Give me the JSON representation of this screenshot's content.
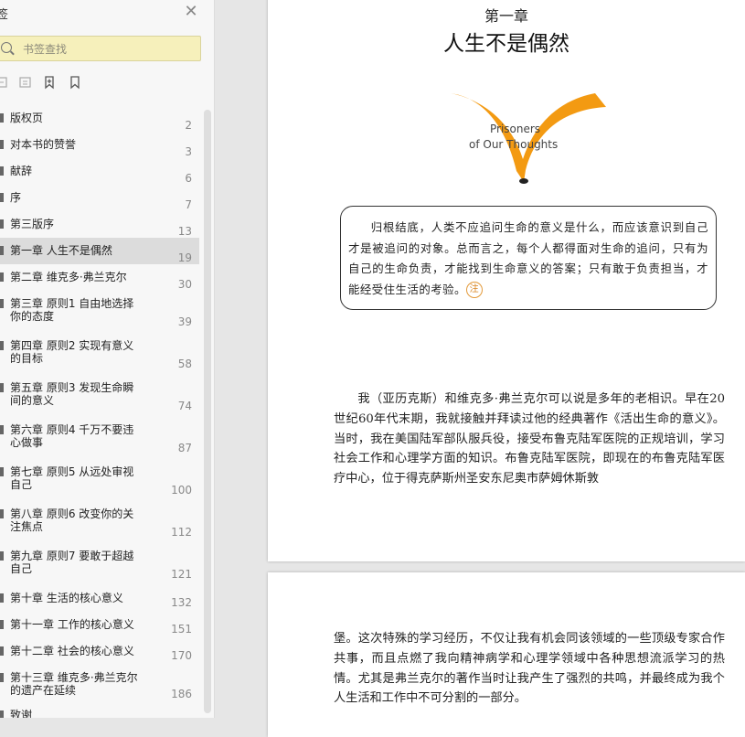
{
  "sidebar": {
    "title": "签",
    "search_placeholder": "书签查找",
    "items": [
      {
        "label": "版权页",
        "page": "2"
      },
      {
        "label": "对本书的赞誉",
        "page": "3"
      },
      {
        "label": "献辞",
        "page": "6"
      },
      {
        "label": "序",
        "page": "7"
      },
      {
        "label": "第三版序",
        "page": "13"
      },
      {
        "label": "第一章  人生不是偶然",
        "page": "19"
      },
      {
        "label": "第二章  维克多·弗兰克尔",
        "page": "30"
      },
      {
        "label": "第三章  原则1  自由地选择你的态度",
        "page": "39"
      },
      {
        "label": "第四章  原则2  实现有意义的目标",
        "page": "58"
      },
      {
        "label": "第五章  原则3  发现生命瞬间的意义",
        "page": "74"
      },
      {
        "label": "第六章  原则4  千万不要违心做事",
        "page": "87"
      },
      {
        "label": "第七章  原则5  从远处审视自己",
        "page": "100"
      },
      {
        "label": "第八章  原则6  改变你的关注焦点",
        "page": "112"
      },
      {
        "label": "第九章  原则7  要敢于超越自己",
        "page": "121"
      },
      {
        "label": "第十章  生活的核心意义",
        "page": "132"
      },
      {
        "label": "第十一章  工作的核心意义",
        "page": "151"
      },
      {
        "label": "第十二章  社会的核心意义",
        "page": "170"
      },
      {
        "label": "第十三章  维克多·弗兰克尔的遗产在延续",
        "page": "186"
      },
      {
        "label": "致谢",
        "page": ""
      }
    ]
  },
  "document": {
    "chapter_number": "第一章",
    "chapter_title": "人生不是偶然",
    "emblem_line1": "Prisoners",
    "emblem_line2": "of Our Thoughts",
    "quote": "归根结底，人类不应追问生命的意义是什么，而应该意识到自己才是被追问的对象。总而言之，每个人都得面对生命的追问，只有为自己的生命负责，才能找到生命意义的答案；只有敢于负责担当，才能经受住生活的考验。",
    "note_mark": "注",
    "paragraph1": "我（亚历克斯）和维克多·弗兰克尔可以说是多年的老相识。早在20世纪60年代末期，我就接触并拜读过他的经典著作《活出生命的意义》。当时，我在美国陆军部队服兵役，接受布鲁克陆军医院的正规培训，学习社会工作和心理学方面的知识。布鲁克陆军医院，即现在的布鲁克陆军医疗中心，位于得克萨斯州圣安东尼奥市萨姆休斯敦",
    "paragraph2": "堡。这次特殊的学习经历，不仅让我有机会同该领域的一些顶级专家合作共事，而且点燃了我向精神病学和心理学领域中各种思想流派学习的热情。尤其是弗兰克尔的著作当时让我产生了强烈的共鸣，并最终成为我个人生活和工作中不可分割的一部分。"
  },
  "colors": {
    "accent_orange": "#f39a12",
    "search_bg": "#f6f0bb"
  }
}
